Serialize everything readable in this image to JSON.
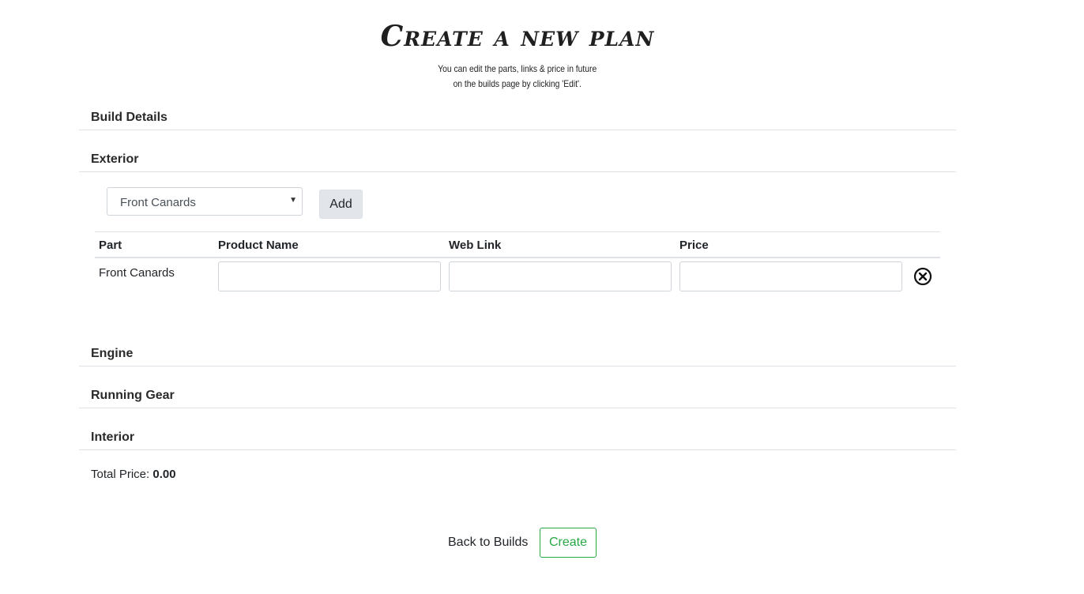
{
  "header": {
    "title": "Create a new plan",
    "subtitle_line1": "You can edit the parts, links & price in future",
    "subtitle_line2": "on the builds page by clicking 'Edit'."
  },
  "sections": {
    "build_details": "Build Details",
    "exterior": "Exterior",
    "engine": "Engine",
    "running_gear": "Running Gear",
    "interior": "Interior"
  },
  "exterior": {
    "part_select_value": "Front Canards",
    "add_label": "Add",
    "table": {
      "columns": [
        "Part",
        "Product Name",
        "Web Link",
        "Price"
      ],
      "rows": [
        {
          "part": "Front Canards",
          "product_name": "",
          "web_link": "",
          "price": ""
        }
      ]
    }
  },
  "total": {
    "label": "Total Price:",
    "value": "0.00"
  },
  "footer": {
    "back_label": "Back to Builds",
    "create_label": "Create"
  },
  "colors": {
    "accent_green": "#28a745",
    "border_gray": "#dee2e6"
  },
  "icons": {
    "remove_row": "close-circle-icon"
  }
}
